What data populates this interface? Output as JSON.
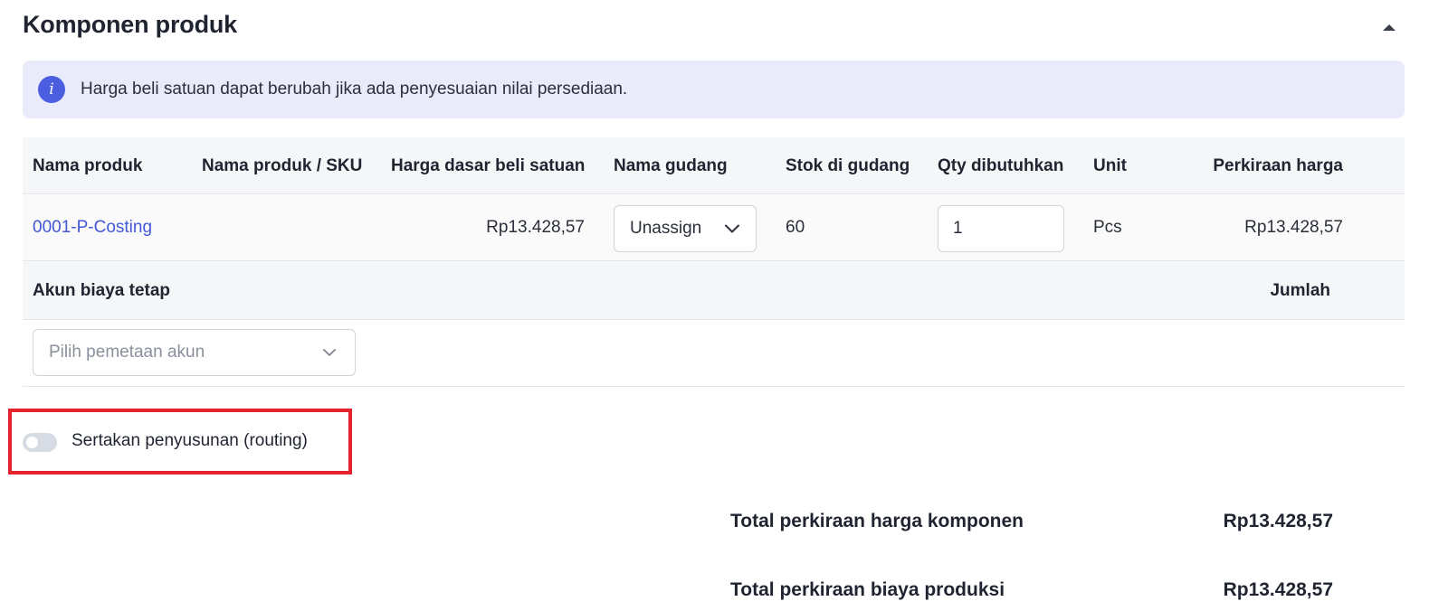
{
  "section": {
    "title": "Komponen produk",
    "collapse_icon": "caret-up-icon"
  },
  "info_banner": {
    "icon": "info-icon",
    "icon_glyph": "i",
    "text": "Harga beli satuan dapat berubah jika ada penyesuaian nilai persediaan.",
    "background": "#e9ebfa",
    "icon_color": "#4b5ee0"
  },
  "components_table": {
    "headers": {
      "product_name": "Nama produk",
      "product_sku": "Nama produk / SKU",
      "base_price": "Harga dasar beli satuan",
      "warehouse": "Nama gudang",
      "stock": "Stok di gudang",
      "qty": "Qty dibutuhkan",
      "unit": "Unit",
      "estimated_price": "Perkiraan harga"
    },
    "rows": [
      {
        "product_name": "0001-P-Costing",
        "product_sku": "",
        "base_price": "Rp13.428,57",
        "warehouse": "Unassign",
        "stock": "60",
        "qty": "1",
        "unit": "Pcs",
        "estimated_price": "Rp13.428,57"
      }
    ]
  },
  "fixed_cost": {
    "headers": {
      "account": "Akun biaya tetap",
      "amount": "Jumlah"
    },
    "account_placeholder": "Pilih pemetaan akun"
  },
  "routing": {
    "label": "Sertakan penyusunan (routing)",
    "enabled": false,
    "highlight_color": "#e3232d"
  },
  "totals": {
    "component_label": "Total perkiraan harga komponen",
    "component_value": "Rp13.428,57",
    "production_label": "Total perkiraan biaya produksi",
    "production_value": "Rp13.428,57"
  },
  "colors": {
    "link": "#4257d6",
    "header_bg": "#f5f6f8",
    "text": "#1f2430"
  }
}
